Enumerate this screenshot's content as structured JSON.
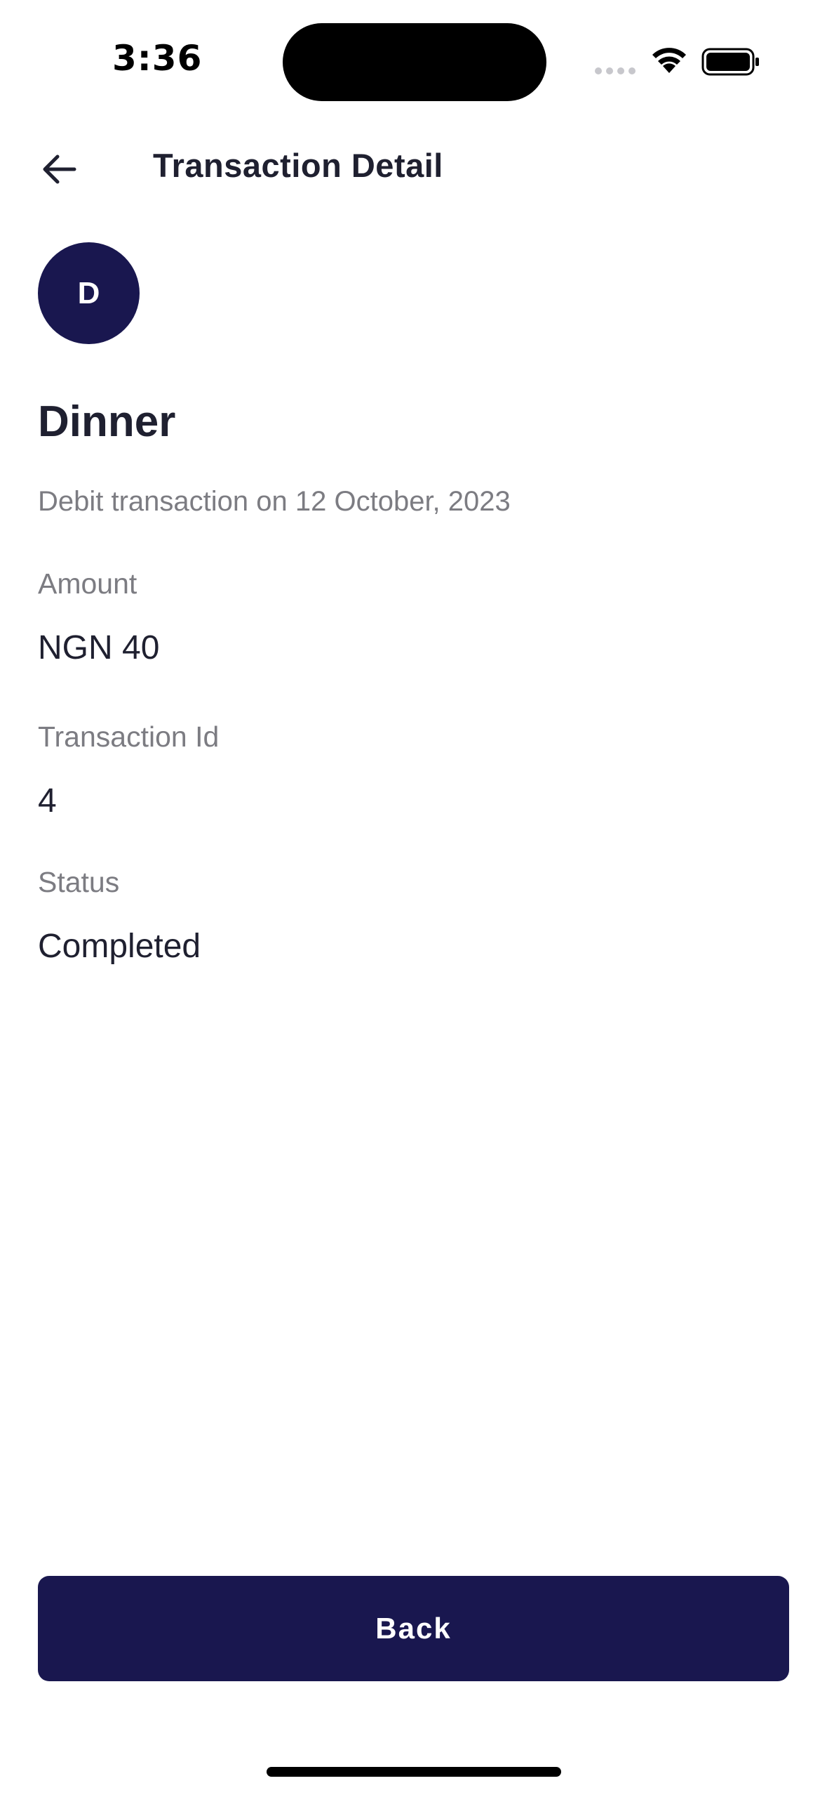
{
  "status_bar": {
    "time": "3:36"
  },
  "header": {
    "title": "Transaction Detail",
    "back_icon": "arrow-left-icon"
  },
  "transaction": {
    "avatar_initial": "D",
    "name": "Dinner",
    "subtitle": "Debit transaction on 12 October, 2023",
    "fields": [
      {
        "label": "Amount",
        "value": "NGN 40"
      },
      {
        "label": "Transaction Id",
        "value": "4"
      },
      {
        "label": "Status",
        "value": "Completed"
      }
    ]
  },
  "footer": {
    "back_label": "Back"
  },
  "colors": {
    "accent": "#19174f",
    "text_primary": "#1f2030",
    "text_secondary": "#7c7c82"
  }
}
